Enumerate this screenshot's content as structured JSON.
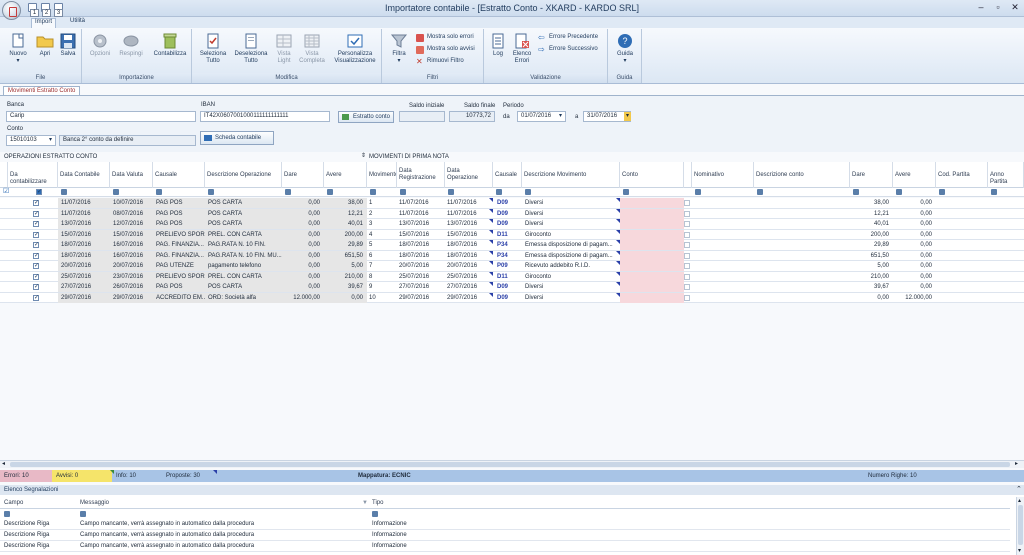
{
  "window": {
    "title": "Importatore contabile - [Estratto Conto - XKARD - KARDO SRL]",
    "qat": [
      "1",
      "2",
      "3"
    ]
  },
  "ribbon_tabs": [
    "Import",
    "Utilità"
  ],
  "ribbon": {
    "file": {
      "label": "File",
      "buttons": [
        "Nuovo",
        "Apri",
        "Salva"
      ]
    },
    "importazione": {
      "label": "Importazione",
      "buttons": [
        "Opzioni",
        "Respingi",
        "Contabilizza"
      ]
    },
    "modifica": {
      "label": "Modifica",
      "buttons": [
        {
          "l1": "Seleziona",
          "l2": "Tutto"
        },
        {
          "l1": "Deseleziona",
          "l2": "Tutto"
        },
        {
          "l1": "Vista",
          "l2": "Light"
        },
        {
          "l1": "Vista",
          "l2": "Completa"
        },
        {
          "l1": "Personalizza",
          "l2": "Visualizzazione"
        }
      ]
    },
    "filtri": {
      "label": "Filtri",
      "filtra": "Filtra",
      "items": [
        "Mostra solo errori",
        "Mostra solo avvisi",
        "Rimuovi Filtro"
      ]
    },
    "validazione": {
      "label": "Validazione",
      "log": "Log",
      "elenco1": "Elenco",
      "elenco2": "Errori",
      "items": [
        "Errore Precedente",
        "Errore Successivo"
      ]
    },
    "guida": {
      "label": "Guida",
      "button": "Guida"
    }
  },
  "doc_tab": "Movimenti Estratto Conto",
  "form": {
    "banca_label": "Banca",
    "banca_value": "Carip",
    "iban_label": "IBAN",
    "iban_value": "IT42X0607001000111111111111",
    "estratto_btn": "Estratto conto",
    "saldo_iniziale_label": "Saldo iniziale",
    "saldo_iniziale_value": "",
    "saldo_finale_label": "Saldo finale",
    "saldo_finale_value": "10773,72",
    "periodo_label": "Periodo",
    "da_label": "da",
    "da_value": "01/07/2016",
    "a_label": "a",
    "a_value": "31/07/2016",
    "conto_label": "Conto",
    "conto_value": "15010103",
    "conto_desc": "Banca 2° conto da definire",
    "scheda_btn": "Scheda contabile"
  },
  "sections": {
    "left": "OPERAZIONI ESTRATTO CONTO",
    "right": "MOVIMENTI DI PRIMA NOTA"
  },
  "columns": {
    "da_contab": "Da contabilizzare",
    "data_contabile": "Data Contabile",
    "data_valuta": "Data Valuta",
    "causale": "Causale",
    "descrizione": "Descrizione Operazione",
    "dare": "Dare",
    "avere": "Avere",
    "movimento": "Movimento",
    "data_reg": "Data Registrazione",
    "data_op": "Data Operazione",
    "causale_pn": "Causale",
    "desc_mov": "Descrizione Movimento",
    "conto": "Conto",
    "nominativo": "Nominativo",
    "desc_conto": "Descrizione conto",
    "dare_pn": "Dare",
    "avere_pn": "Avere",
    "cod_partita": "Cod. Partita",
    "anno_partita": "Anno Partita"
  },
  "rows": [
    {
      "dc": "11/07/2016",
      "dv": "10/07/2016",
      "caus": "PAG POS",
      "desc": "POS CARTA",
      "dare": "0,00",
      "avere": "38,00",
      "mov": "1",
      "dr": "11/07/2016",
      "dop": "11/07/2016",
      "cpn": "D09",
      "dm": "Diversi",
      "dpn": "38,00",
      "apn": "0,00"
    },
    {
      "dc": "11/07/2016",
      "dv": "08/07/2016",
      "caus": "PAG POS",
      "desc": "POS CARTA",
      "dare": "0,00",
      "avere": "12,21",
      "mov": "2",
      "dr": "11/07/2016",
      "dop": "11/07/2016",
      "cpn": "D09",
      "dm": "Diversi",
      "dpn": "12,21",
      "apn": "0,00"
    },
    {
      "dc": "13/07/2016",
      "dv": "12/07/2016",
      "caus": "PAG POS",
      "desc": "POS CARTA",
      "dare": "0,00",
      "avere": "40,01",
      "mov": "3",
      "dr": "13/07/2016",
      "dop": "13/07/2016",
      "cpn": "D09",
      "dm": "Diversi",
      "dpn": "40,01",
      "apn": "0,00"
    },
    {
      "dc": "15/07/2016",
      "dv": "15/07/2016",
      "caus": "PRELIEVO SPOR...",
      "desc": "PREL. CON CARTA",
      "dare": "0,00",
      "avere": "200,00",
      "mov": "4",
      "dr": "15/07/2016",
      "dop": "15/07/2016",
      "cpn": "D11",
      "dm": "Giroconto",
      "dpn": "200,00",
      "apn": "0,00"
    },
    {
      "dc": "18/07/2016",
      "dv": "16/07/2016",
      "caus": "PAG. FINANZIA...",
      "desc": "PAG.RATA N. 10 FIN.",
      "dare": "0,00",
      "avere": "29,89",
      "mov": "5",
      "dr": "18/07/2016",
      "dop": "18/07/2016",
      "cpn": "P34",
      "dm": "Emessa disposizione di pagam...",
      "dpn": "29,89",
      "apn": "0,00"
    },
    {
      "dc": "18/07/2016",
      "dv": "16/07/2016",
      "caus": "PAG. FINANZIA...",
      "desc": "PAG.RATA N. 10 FIN. MU...",
      "dare": "0,00",
      "avere": "651,50",
      "mov": "6",
      "dr": "18/07/2016",
      "dop": "18/07/2016",
      "cpn": "P34",
      "dm": "Emessa disposizione di pagam...",
      "dpn": "651,50",
      "apn": "0,00"
    },
    {
      "dc": "20/07/2016",
      "dv": "20/07/2016",
      "caus": "PAG UTENZE",
      "desc": "pagamento telefono",
      "dare": "0,00",
      "avere": "5,00",
      "mov": "7",
      "dr": "20/07/2016",
      "dop": "20/07/2016",
      "cpn": "P09",
      "dm": "Ricevuto addebito R.I.D.",
      "dpn": "5,00",
      "apn": "0,00"
    },
    {
      "dc": "25/07/2016",
      "dv": "23/07/2016",
      "caus": "PRELIEVO SPOR...",
      "desc": "PREL. CON CARTA",
      "dare": "0,00",
      "avere": "210,00",
      "mov": "8",
      "dr": "25/07/2016",
      "dop": "25/07/2016",
      "cpn": "D11",
      "dm": "Giroconto",
      "dpn": "210,00",
      "apn": "0,00"
    },
    {
      "dc": "27/07/2016",
      "dv": "26/07/2016",
      "caus": "PAG POS",
      "desc": "POS CARTA",
      "dare": "0,00",
      "avere": "39,67",
      "mov": "9",
      "dr": "27/07/2016",
      "dop": "27/07/2016",
      "cpn": "D09",
      "dm": "Diversi",
      "dpn": "39,67",
      "apn": "0,00"
    },
    {
      "dc": "29/07/2016",
      "dv": "29/07/2016",
      "caus": "ACCREDITO EM...",
      "desc": "ORD: Società alfa",
      "dare": "12.000,00",
      "avere": "0,00",
      "mov": "10",
      "dr": "29/07/2016",
      "dop": "29/07/2016",
      "cpn": "D09",
      "dm": "Diversi",
      "dpn": "0,00",
      "apn": "12.000,00"
    }
  ],
  "status": {
    "errori": "Errori: 10",
    "avvisi": "Avvisi: 0",
    "info": "Info: 10",
    "proposte": "Proposte: 30",
    "mappatura": "Mappatura: ECNIC",
    "numero_righe": "Numero Righe: 10"
  },
  "elenco": {
    "title": "Elenco Segnalazioni",
    "headers": [
      "Campo",
      "Messaggio",
      "Tipo"
    ],
    "rows": [
      [
        "Descrizione Riga",
        "Campo mancante, verrà assegnato in automatico dalla procedura",
        "Informazione"
      ],
      [
        "Descrizione Riga",
        "Campo mancante, verrà assegnato in automatico dalla procedura",
        "Informazione"
      ],
      [
        "Descrizione Riga",
        "Campo mancante, verrà assegnato in automatico dalla procedura",
        "Informazione"
      ]
    ]
  },
  "colors": {
    "errori": "#e8b9c6",
    "avvisi": "#f5e46a",
    "conto": "#f7d8dc",
    "greyed": "#e6e6e6"
  }
}
